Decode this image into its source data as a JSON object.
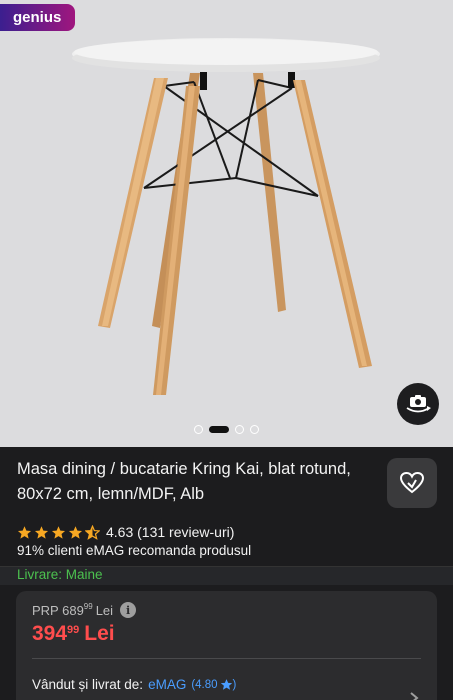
{
  "badge": {
    "label": "genius"
  },
  "gallery": {
    "active_index": 1,
    "count": 4
  },
  "product": {
    "title": "Masa dining / bucatarie Kring Kai, blat rotund, 80x72 cm, lemn/MDF, Alb",
    "rating_text": "4.63 (131 review-uri)",
    "rating_value": 4.63,
    "recommend_text": "91% clienti eMAG recomanda produsul"
  },
  "delivery": {
    "label": "Livrare: Maine"
  },
  "pricing": {
    "prp_prefix": "PRP 689",
    "prp_decimals": "99",
    "prp_currency": "Lei",
    "price_main": "394",
    "price_decimals": "99",
    "price_currency": "Lei"
  },
  "seller": {
    "label": "Vândut și livrat de:",
    "name": "eMAG",
    "rating": "(4.80",
    "rating_close": ")"
  },
  "colors": {
    "accent_red": "#ff4d4d",
    "link_blue": "#4a9dff",
    "delivery_green": "#4cc14f",
    "star": "#f7a823"
  },
  "icons": {
    "camera": "camera-rotate-icon",
    "favorite": "heart-icon",
    "info": "info-icon",
    "chevron": "chevron-right-icon"
  }
}
